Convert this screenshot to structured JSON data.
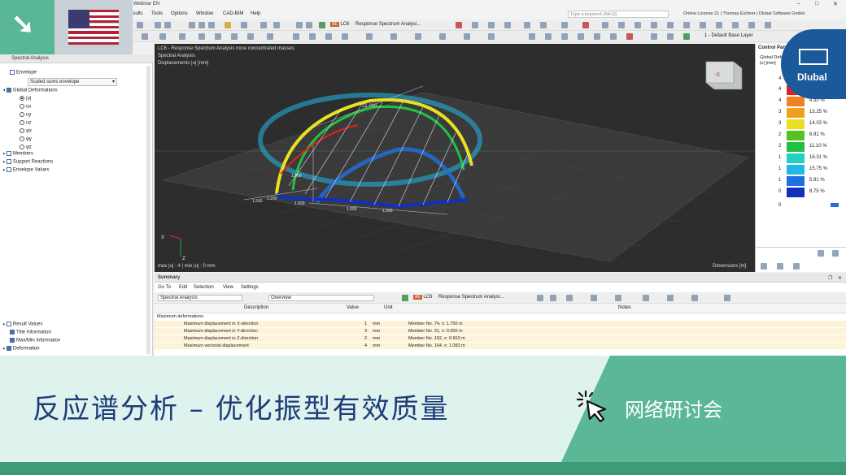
{
  "app": {
    "window_title": "Webinar EN",
    "menu": [
      "esults",
      "Tools",
      "Options",
      "Window",
      "CAD-BIM",
      "Help"
    ],
    "search_placeholder": "Type a keyword (Alt+Q)",
    "license": "Online License 21 | Thomas Eichner | Dlubal Software GmbH",
    "loadcase_code": "AE",
    "loadcase_id": "LC6",
    "loadcase_name": "Response Spectrum Analysi...",
    "layer": "1 - Default Base Layer"
  },
  "navigator": {
    "title": "Spectral Analysis",
    "envelope_label": "Envelope",
    "envelope_select": "Scaled sums envelope",
    "global_deformations": "Global Deformations",
    "deform_items": [
      "|u|",
      "ux",
      "uy",
      "uz",
      "φx",
      "φy",
      "φz"
    ],
    "members": "Members",
    "support_reactions": "Support Reactions",
    "envelope_values": "Envelope Values",
    "bottom_items": [
      "Result Values",
      "Title Information",
      "Max/Min Information",
      "Deformation"
    ]
  },
  "viewport": {
    "line1": "LC6 - Response Spectrum Analysis noce concentrated masses",
    "line2": "Spectral Analysis",
    "line3": "Displacements |u| [mm]",
    "footer_left": "max |u| : 4 | min |u| : 0 mm",
    "footer_right": "Dimensions [m]",
    "dimensions": [
      "21.000",
      "1.000",
      "1.000",
      "1.000",
      "1.200",
      "1.500",
      "1.200"
    ],
    "axis_x": "X",
    "axis_z": "Z",
    "cube_label": "-X"
  },
  "control_panel": {
    "title": "Control Panel",
    "subtitle": "Global Deformations",
    "unit": "|u| [mm]",
    "legend": [
      {
        "value": "4",
        "color": "#e02020",
        "pct": ""
      },
      {
        "value": "4",
        "color": "#f08020",
        "pct": "4.30 %"
      },
      {
        "value": "3",
        "color": "#f0a020",
        "pct": "13.25 %"
      },
      {
        "value": "3",
        "color": "#e8e020",
        "pct": "14.03 %"
      },
      {
        "value": "2",
        "color": "#58c020",
        "pct": "6.91 %"
      },
      {
        "value": "2",
        "color": "#20c040",
        "pct": "11.10 %"
      },
      {
        "value": "1",
        "color": "#20d0c0",
        "pct": "16.31 %"
      },
      {
        "value": "1",
        "color": "#20b8e8",
        "pct": "15.75 %"
      },
      {
        "value": "1",
        "color": "#2070e0",
        "pct": "5.91 %"
      },
      {
        "value": "0",
        "color": "#1030c0",
        "pct": "8.75 %"
      }
    ],
    "scale_top_value": "4",
    "scale_bottom_value": "0"
  },
  "brand": {
    "name": "Dlubal"
  },
  "summary": {
    "title": "Summary",
    "menu": [
      "Go To",
      "Edit",
      "Selection",
      "View",
      "Settings"
    ],
    "analysis_select": "Spectral Analysis",
    "overview_select": "Overview",
    "loadcase_code": "AE",
    "loadcase_id": "LC6",
    "loadcase_name": "Response Spectrum Analysi...",
    "columns": [
      "Description",
      "Value",
      "Unit",
      "Notes"
    ],
    "group": "Maximum deformations",
    "rows": [
      {
        "desc": "Maximum displacement in X-direction",
        "value": "1",
        "unit": "mm",
        "notes": "Member No. 74, x: 1.750 m"
      },
      {
        "desc": "Maximum displacement in Y-direction",
        "value": "3",
        "unit": "mm",
        "notes": "Member No. 31, x: 0.000 m"
      },
      {
        "desc": "Maximum displacement in Z-direction",
        "value": "2",
        "unit": "mm",
        "notes": "Member No. 162, x: 0.963 m"
      },
      {
        "desc": "Maximum vectorial displacement",
        "value": "4",
        "unit": "mm",
        "notes": "Member No. 164, x: 1.083 m"
      }
    ]
  },
  "banner": {
    "title": "反应谱分析 – 优化振型有效质量",
    "tag": "网络研讨会",
    "accent": "#5bb796",
    "title_color": "#1d3c78"
  }
}
